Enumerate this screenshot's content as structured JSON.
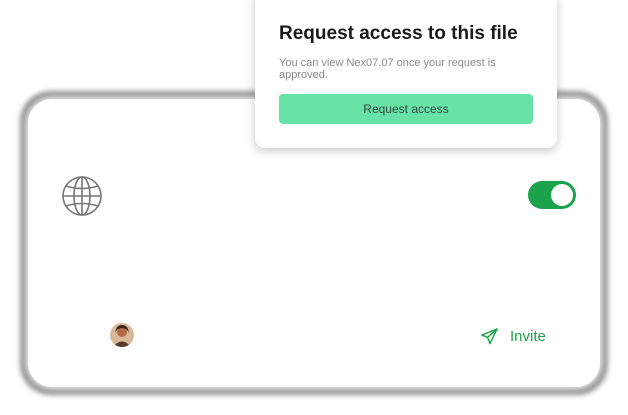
{
  "popup": {
    "title": "Request access to this file",
    "description": "You can view Nex07.07 once your request is approved.",
    "button_label": "Request access"
  },
  "card": {
    "globe_icon": "globe-icon",
    "toggle_on": true,
    "avatar": "user-avatar",
    "invite_icon": "paper-plane-icon",
    "invite_label": "Invite"
  },
  "colors": {
    "accent_green": "#1aa34a",
    "button_green": "#68e3a8",
    "frame_dark": "#555555"
  }
}
